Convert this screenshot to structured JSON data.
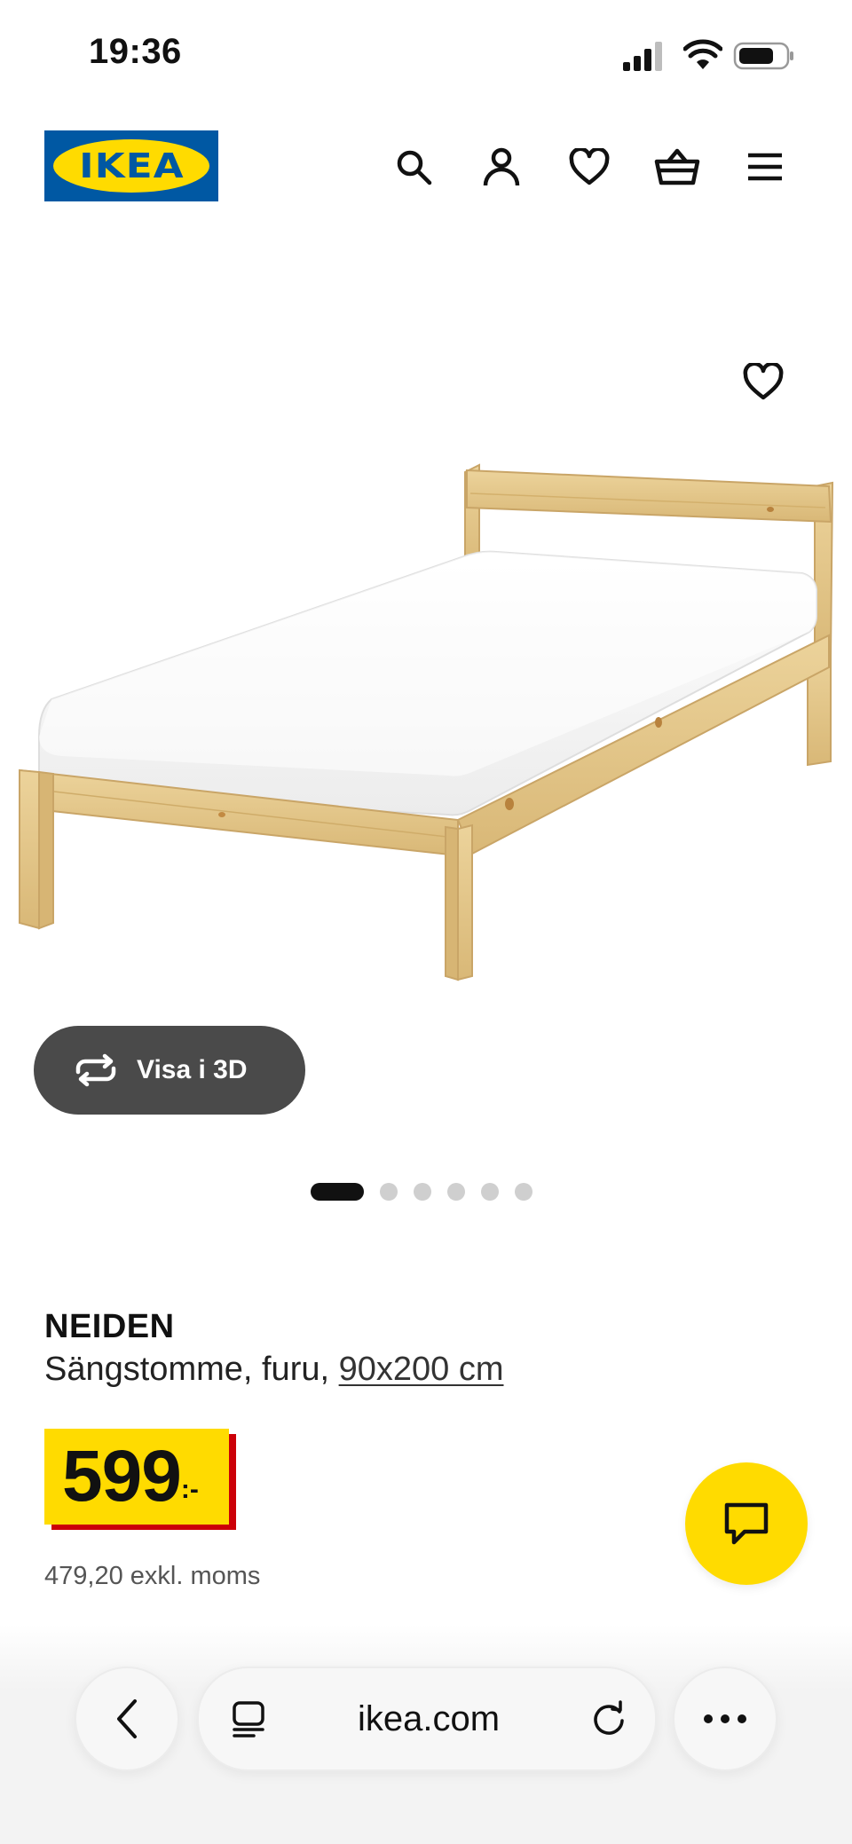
{
  "status_bar": {
    "time": "19:36"
  },
  "header": {
    "logo_text": "IKEA",
    "icons": [
      "search-icon",
      "user-icon",
      "heart-icon",
      "basket-icon",
      "menu-icon"
    ]
  },
  "gallery": {
    "view3d_label": "Visa i 3D",
    "page_count": 6,
    "active_index": 0
  },
  "product": {
    "name": "NEIDEN",
    "description": "Sängstomme, furu,",
    "size_link": "90x200 cm",
    "price_integer": "599",
    "price_suffix": ":-",
    "price_excl_vat": "479,20 exkl. moms"
  },
  "browser": {
    "url": "ikea.com"
  },
  "colors": {
    "brand_blue": "#0058a3",
    "brand_yellow": "#ffdb00",
    "price_red": "#cc0008",
    "button_dark": "#4a4a4a"
  }
}
